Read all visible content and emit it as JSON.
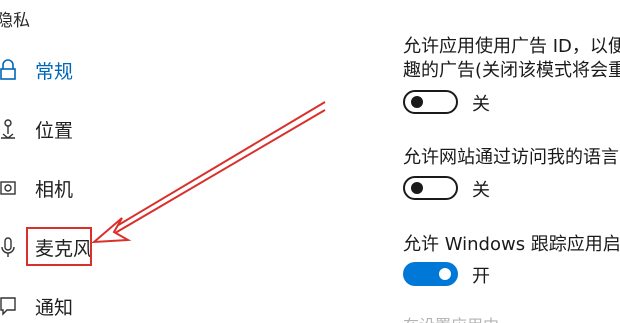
{
  "section": {
    "title": "隐私"
  },
  "nav": {
    "items": [
      {
        "label": "常规",
        "icon": "lock-icon"
      },
      {
        "label": "位置",
        "icon": "location-icon"
      },
      {
        "label": "相机",
        "icon": "camera-icon"
      },
      {
        "label": "麦克风",
        "icon": "microphone-icon"
      },
      {
        "label": "通知",
        "icon": "notification-icon"
      }
    ]
  },
  "settings": {
    "ad_id_line1": "允许应用使用广告 ID，以便",
    "ad_id_line2": "趣的广告(关闭该模式将会重",
    "ad_id_state": "关",
    "language_text": "允许网站通过访问我的语言",
    "language_state": "关",
    "tracking_text": "允许 Windows 跟踪应用启",
    "tracking_state": "开",
    "faded_text": "在设置应用中"
  },
  "colors": {
    "accent": "#0078d7",
    "annotation": "#d9302c"
  }
}
